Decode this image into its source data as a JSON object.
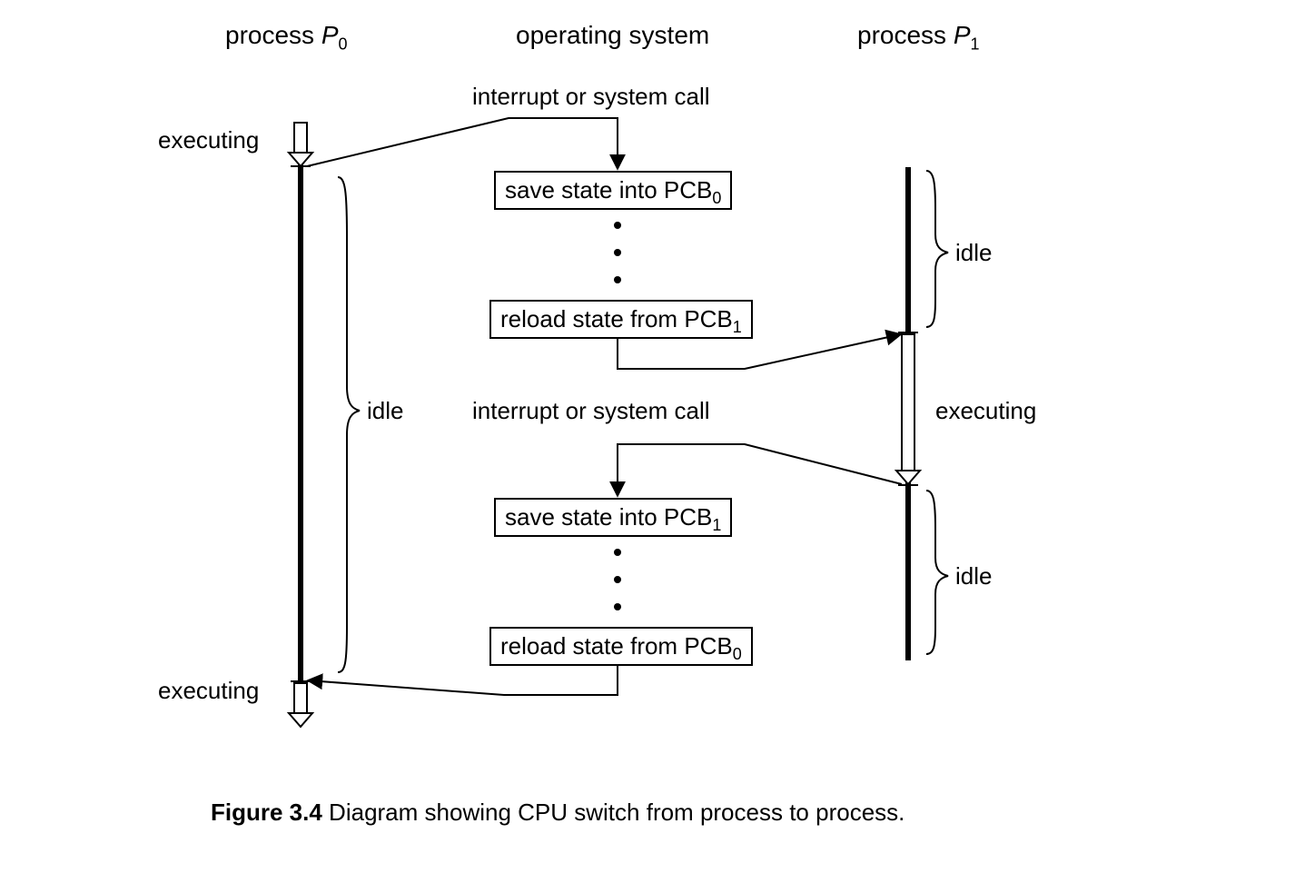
{
  "headers": {
    "col1_pre": "process ",
    "col1_ital": "P",
    "col1_sub": "0",
    "col2": "operating system",
    "col3_pre": "process ",
    "col3_ital": "P",
    "col3_sub": "1"
  },
  "labels": {
    "interrupt1": "interrupt or system call",
    "interrupt2": "interrupt or system call",
    "exec_top": "executing",
    "exec_mid": "executing",
    "exec_bot": "executing",
    "idle_left": "idle",
    "idle_right1": "idle",
    "idle_right2": "idle"
  },
  "boxes": {
    "save0_pre": "save state into PCB",
    "save0_sub": "0",
    "reload1_pre": "reload state from PCB",
    "reload1_sub": "1",
    "save1_pre": "save state into PCB",
    "save1_sub": "1",
    "reload0_pre": "reload state from PCB",
    "reload0_sub": "0"
  },
  "caption": {
    "fignum": "Figure 3.4",
    "text": "   Diagram showing CPU switch from process to process."
  }
}
